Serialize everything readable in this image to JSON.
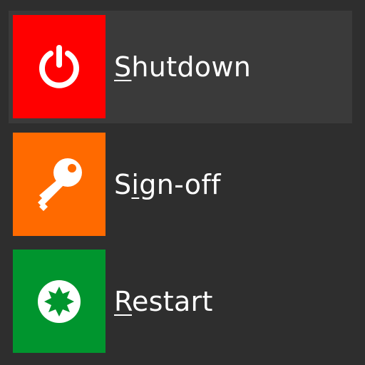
{
  "colors": {
    "background": "#2e2e2e",
    "selected_row": "#3a3a3a",
    "shutdown_tile": "#ff0000",
    "signoff_tile": "#ff6a00",
    "restart_tile": "#00952e",
    "text": "#ffffff"
  },
  "menu": {
    "items": [
      {
        "id": "shutdown",
        "icon": "power-icon",
        "label": "Shutdown",
        "mnemonic": "S",
        "rest": "hutdown",
        "selected": true
      },
      {
        "id": "sign-off",
        "icon": "key-icon",
        "label": "Sign-off",
        "pre": "S",
        "mnemonic": "i",
        "rest": "gn-off",
        "selected": false
      },
      {
        "id": "restart",
        "icon": "restart-icon",
        "label": "Restart",
        "mnemonic": "R",
        "rest": "estart",
        "selected": false
      }
    ]
  }
}
